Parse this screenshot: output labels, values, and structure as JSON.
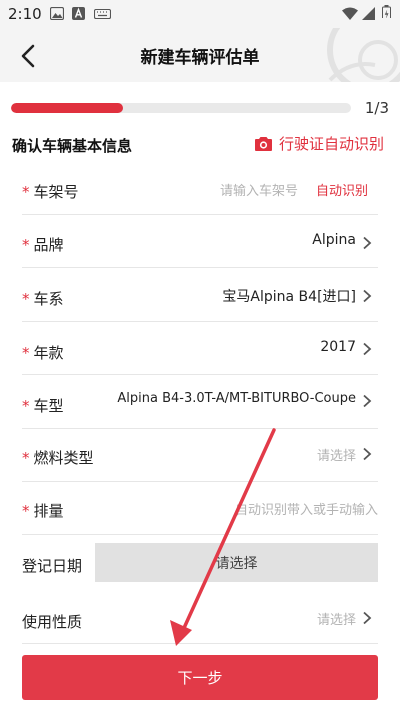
{
  "status_bar": {
    "time": "2:10"
  },
  "header": {
    "title": "新建车辆评估单"
  },
  "progress": {
    "text": "1/3",
    "fraction": 0.33
  },
  "section": {
    "title": "确认车辆基本信息",
    "ocr_label": "行驶证自动识别"
  },
  "fields": {
    "vin": {
      "label": "车架号",
      "placeholder": "请输入车架号",
      "action": "自动识别"
    },
    "brand": {
      "label": "品牌",
      "value": "Alpina"
    },
    "series": {
      "label": "车系",
      "value": "宝马Alpina B4[进口]"
    },
    "year": {
      "label": "年款",
      "value": "2017"
    },
    "model": {
      "label": "车型",
      "value": "Alpina B4-3.0T-A/MT-BITURBO-Coupe"
    },
    "fuel": {
      "label": "燃料类型",
      "placeholder": "请选择"
    },
    "displacement": {
      "label": "排量",
      "placeholder": "自动识别带入或手动输入"
    },
    "reg_date": {
      "label": "登记日期",
      "placeholder": "请选择"
    },
    "usage": {
      "label": "使用性质",
      "placeholder": "请选择"
    }
  },
  "required_mark": "*",
  "next_button": "下一步",
  "colors": {
    "accent": "#e0313e",
    "button": "#e23a48",
    "arrow": "#e23a48"
  }
}
